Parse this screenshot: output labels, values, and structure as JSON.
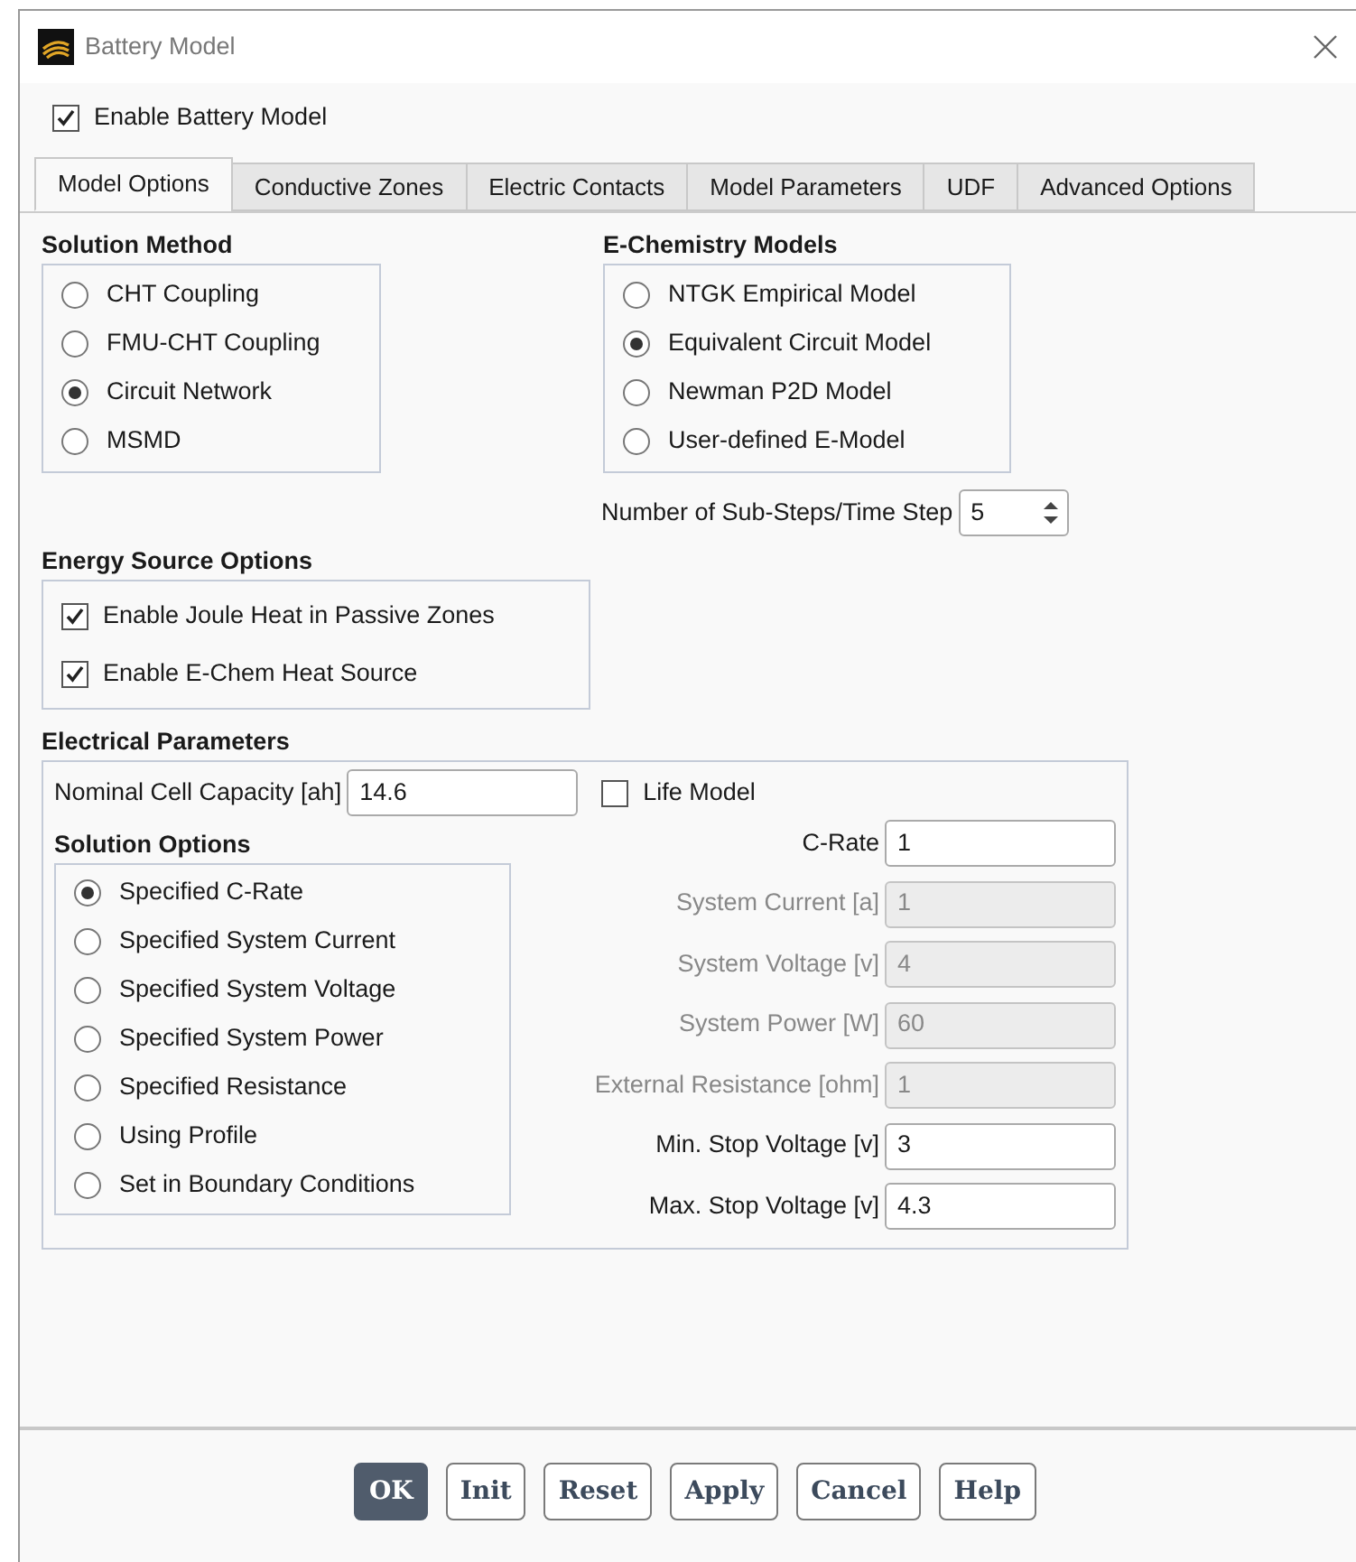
{
  "window": {
    "title": "Battery Model"
  },
  "enable_battery_model": {
    "label": "Enable Battery Model",
    "checked": true
  },
  "tabs": [
    {
      "label": "Model Options",
      "selected": true
    },
    {
      "label": "Conductive Zones",
      "selected": false
    },
    {
      "label": "Electric Contacts",
      "selected": false
    },
    {
      "label": "Model Parameters",
      "selected": false
    },
    {
      "label": "UDF",
      "selected": false
    },
    {
      "label": "Advanced Options",
      "selected": false
    }
  ],
  "solution_method": {
    "title": "Solution Method",
    "options": [
      {
        "label": "CHT Coupling",
        "selected": false
      },
      {
        "label": "FMU-CHT Coupling",
        "selected": false
      },
      {
        "label": "Circuit Network",
        "selected": true
      },
      {
        "label": "MSMD",
        "selected": false
      }
    ]
  },
  "e_chemistry_models": {
    "title": "E-Chemistry Models",
    "options": [
      {
        "label": "NTGK Empirical Model",
        "selected": false
      },
      {
        "label": "Equivalent Circuit Model",
        "selected": true
      },
      {
        "label": "Newman P2D Model",
        "selected": false
      },
      {
        "label": "User-defined E-Model",
        "selected": false
      }
    ]
  },
  "sub_steps": {
    "label": "Number of Sub-Steps/Time Step",
    "value": "5"
  },
  "energy_source_options": {
    "title": "Energy Source Options",
    "options": [
      {
        "label": "Enable Joule Heat in Passive Zones",
        "checked": true
      },
      {
        "label": "Enable E-Chem Heat Source",
        "checked": true
      }
    ]
  },
  "electrical_parameters": {
    "title": "Electrical Parameters",
    "nominal_capacity": {
      "label": "Nominal Cell Capacity [ah]",
      "value": "14.6"
    },
    "life_model": {
      "label": "Life Model",
      "checked": false
    },
    "solution_options": {
      "title": "Solution Options",
      "options": [
        {
          "label": "Specified C-Rate",
          "selected": true
        },
        {
          "label": "Specified System Current",
          "selected": false
        },
        {
          "label": "Specified System Voltage",
          "selected": false
        },
        {
          "label": "Specified System Power",
          "selected": false
        },
        {
          "label": "Specified Resistance",
          "selected": false
        },
        {
          "label": "Using Profile",
          "selected": false
        },
        {
          "label": "Set in Boundary Conditions",
          "selected": false
        }
      ]
    },
    "fields": [
      {
        "label": "C-Rate",
        "value": "1",
        "disabled": false
      },
      {
        "label": "System Current [a]",
        "value": "1",
        "disabled": true
      },
      {
        "label": "System Voltage [v]",
        "value": "4",
        "disabled": true
      },
      {
        "label": "System Power [W]",
        "value": "60",
        "disabled": true
      },
      {
        "label": "External Resistance [ohm]",
        "value": "1",
        "disabled": true
      },
      {
        "label": "Min. Stop Voltage [v]",
        "value": "3",
        "disabled": false
      },
      {
        "label": "Max. Stop Voltage [v]",
        "value": "4.3",
        "disabled": false
      }
    ]
  },
  "buttons": [
    {
      "label": "OK",
      "kind": "default"
    },
    {
      "label": "Init",
      "kind": "normal"
    },
    {
      "label": "Reset",
      "kind": "normal"
    },
    {
      "label": "Apply",
      "kind": "normal"
    },
    {
      "label": "Cancel",
      "kind": "normal"
    },
    {
      "label": "Help",
      "kind": "normal"
    }
  ]
}
